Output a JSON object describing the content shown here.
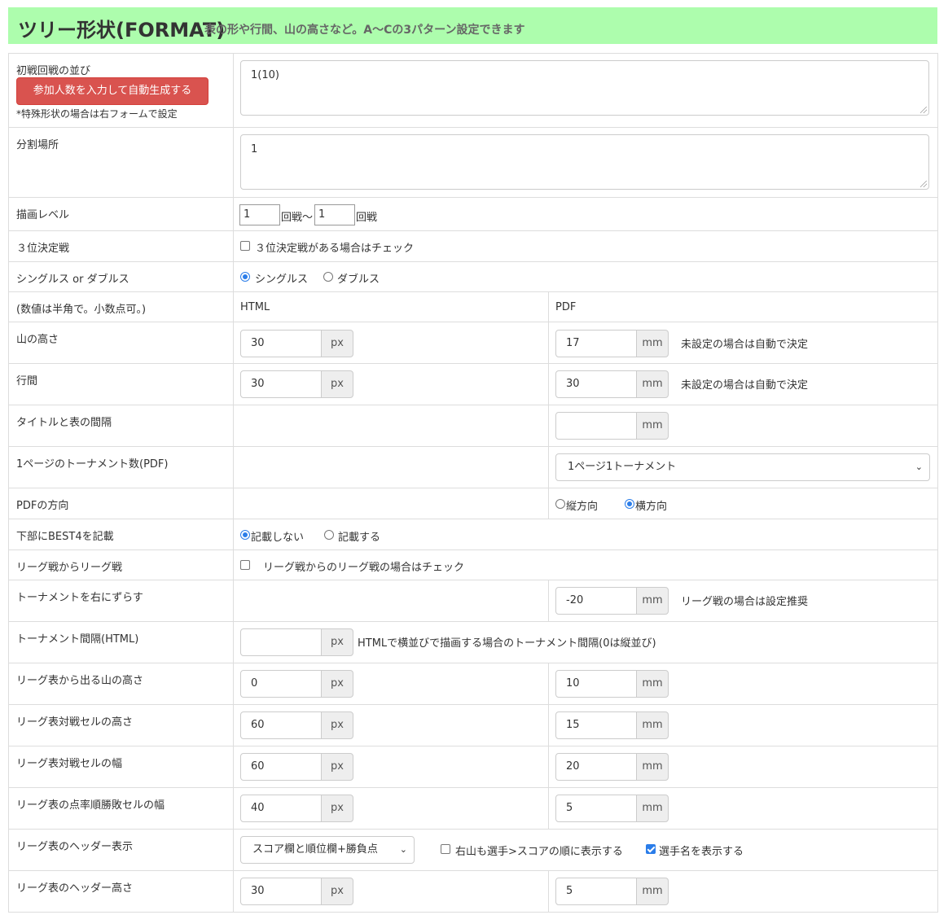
{
  "header": {
    "title": "ツリー形状(FORMAT)",
    "subtitle": "表の形や行間、山の高さなど。A〜Cの3パターン設定できます"
  },
  "rows": {
    "shosen": {
      "label": "初戦回戦の並び",
      "button": "参加人数を入力して自動生成する",
      "note": "*特殊形状の場合は右フォームで設定",
      "value": "1(10)"
    },
    "bunkatsu": {
      "label": "分割場所",
      "value": "1"
    },
    "level": {
      "label": "描画レベル",
      "from": "1",
      "from_unit": "回戦〜",
      "to": "1",
      "to_unit": "回戦"
    },
    "third": {
      "label": "３位決定戦",
      "checkbox_label": "３位決定戦がある場合はチェック",
      "checked": false
    },
    "singles": {
      "label": "シングルス or ダブルス",
      "opt1": "シングルス",
      "opt2": "ダブルス",
      "selected": "シングルス"
    },
    "colhead": {
      "label": "(数値は半角で。小数点可。)",
      "html": "HTML",
      "pdf": "PDF"
    },
    "yama": {
      "label": "山の高さ",
      "html_value": "30",
      "html_unit": "px",
      "pdf_value": "17",
      "pdf_unit": "mm",
      "note": "未設定の場合は自動で決定"
    },
    "gyokan": {
      "label": "行間",
      "html_value": "30",
      "html_unit": "px",
      "pdf_value": "30",
      "pdf_unit": "mm",
      "note": "未設定の場合は自動で決定"
    },
    "title_gap": {
      "label": "タイトルと表の間隔",
      "pdf_value": "",
      "pdf_unit": "mm"
    },
    "per_page": {
      "label": "1ページのトーナメント数(PDF)",
      "selected": "1ページ1トーナメント"
    },
    "pdf_dir": {
      "label": "PDFの方向",
      "opt1": "縦方向",
      "opt2": "横方向",
      "selected": "横方向"
    },
    "best4": {
      "label": "下部にBEST4を記載",
      "opt1": "記載しない",
      "opt2": "記載する",
      "selected": "記載しない"
    },
    "league": {
      "label": "リーグ戦からリーグ戦",
      "checkbox_label": "リーグ戦からのリーグ戦の場合はチェック",
      "checked": false
    },
    "shift": {
      "label": "トーナメントを右にずらす",
      "pdf_value": "-20",
      "pdf_unit": "mm",
      "note": "リーグ戦の場合は設定推奨"
    },
    "t_gap": {
      "label": "トーナメント間隔(HTML)",
      "html_value": "",
      "html_unit": "px",
      "note": "HTMLで横並びで描画する場合のトーナメント間隔(0は縦並び)"
    },
    "league_yama": {
      "label": "リーグ表から出る山の高さ",
      "html_value": "0",
      "html_unit": "px",
      "pdf_value": "10",
      "pdf_unit": "mm"
    },
    "cell_h": {
      "label": "リーグ表対戦セルの高さ",
      "html_value": "60",
      "html_unit": "px",
      "pdf_value": "15",
      "pdf_unit": "mm"
    },
    "cell_w": {
      "label": "リーグ表対戦セルの幅",
      "html_value": "60",
      "html_unit": "px",
      "pdf_value": "20",
      "pdf_unit": "mm"
    },
    "score_w": {
      "label": "リーグ表の点率順勝敗セルの幅",
      "html_value": "40",
      "html_unit": "px",
      "pdf_value": "5",
      "pdf_unit": "mm"
    },
    "hdr_disp": {
      "label": "リーグ表のヘッダー表示",
      "selected": "スコア欄と順位欄+勝負点",
      "check1": "右山も選手>スコアの順に表示する",
      "check1_on": false,
      "check2": "選手名を表示する",
      "check2_on": true
    },
    "hdr_h": {
      "label": "リーグ表のヘッダー高さ",
      "html_value": "30",
      "html_unit": "px",
      "pdf_value": "5",
      "pdf_unit": "mm"
    }
  },
  "colors": {
    "header_bg": "#adfdad",
    "danger": "#d9534f",
    "accent": "#2b7de9"
  }
}
